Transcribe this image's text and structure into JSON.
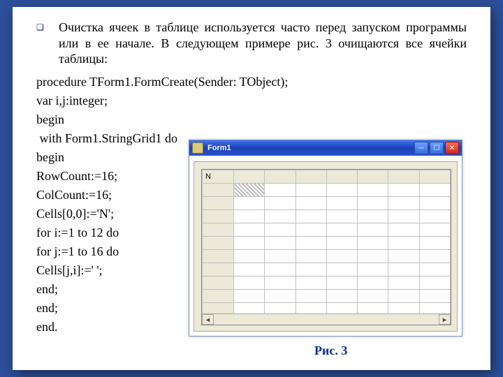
{
  "intro": "Очистка ячеек в таблице используется часто перед запуском программы или в ее начале. В следующем примере рис. 3 очищаются все ячейки таблицы:",
  "code": [
    "procedure TForm1.FormCreate(Sender: TObject);",
    "var i,j:integer;",
    "begin",
    " with Form1.StringGrid1 do",
    "begin",
    "RowCount:=16;",
    "ColCount:=16;",
    "Cells[0,0]:='N';",
    "for i:=1 to 12 do",
    "for j:=1 to 16 do",
    "Cells[j,i]:=' ';",
    "end;",
    "end;",
    "end."
  ],
  "window": {
    "title": "Form1"
  },
  "grid": {
    "header_cell": "N"
  },
  "caption": "Рис. 3"
}
